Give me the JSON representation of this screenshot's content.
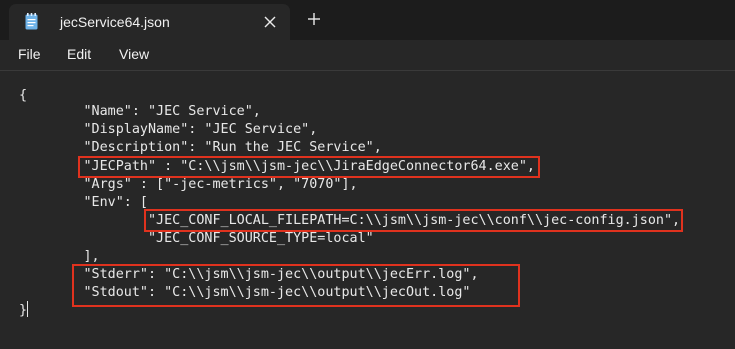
{
  "tab": {
    "title": "jecService64.json",
    "file_icon": "notepad-file-icon",
    "close_icon": "close-icon",
    "new_tab_icon": "plus-icon"
  },
  "menu": {
    "file": "File",
    "edit": "Edit",
    "view": "View"
  },
  "editor": {
    "lines": [
      "{",
      "        \"Name\": \"JEC Service\",",
      "        \"DisplayName\": \"JEC Service\",",
      "        \"Description\": \"Run the JEC Service\",",
      "        \"JECPath\" : \"C:\\\\jsm\\\\jsm-jec\\\\JiraEdgeConnector64.exe\",",
      "        \"Args\" : [\"-jec-metrics\", \"7070\"],",
      "        \"Env\": [",
      "                \"JEC_CONF_LOCAL_FILEPATH=C:\\\\jsm\\\\jsm-jec\\\\conf\\\\jec-config.json\",",
      "                \"JEC_CONF_SOURCE_TYPE=local\"",
      "        ],",
      "        \"Stderr\": \"C:\\\\jsm\\\\jsm-jec\\\\output\\\\jecErr.log\",",
      "        \"Stdout\": \"C:\\\\jsm\\\\jsm-jec\\\\output\\\\jecOut.log\"",
      "",
      "}"
    ]
  },
  "colors": {
    "background": "#272727",
    "titlebar": "#1c1c1c",
    "highlight_box": "#e0321e",
    "text": "#e8e8e8"
  }
}
